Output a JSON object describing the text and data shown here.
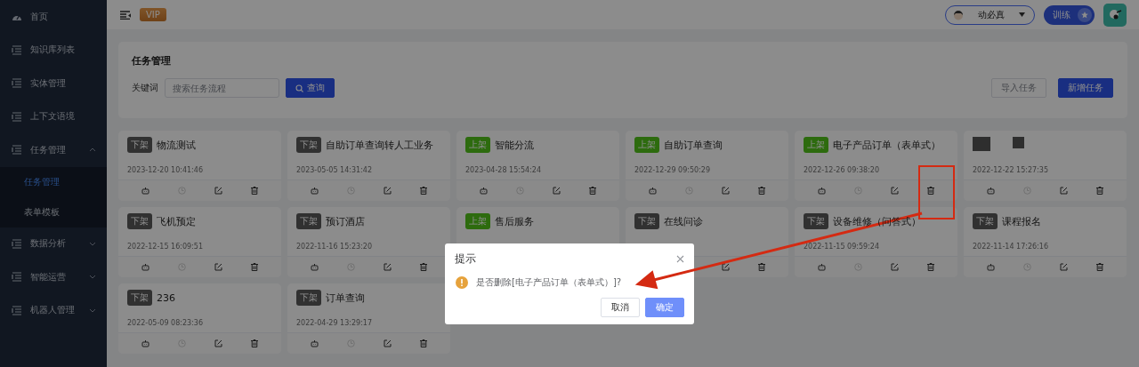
{
  "sidebar": {
    "items": [
      {
        "label": "首页",
        "kind": "dashboard"
      },
      {
        "label": "知识库列表",
        "kind": "list"
      },
      {
        "label": "实体管理",
        "kind": "list"
      },
      {
        "label": "上下文语境",
        "kind": "list"
      },
      {
        "label": "任务管理",
        "kind": "list",
        "expanded": true,
        "children": [
          {
            "label": "任务管理",
            "selected": true
          },
          {
            "label": "表单模板",
            "selected": false
          }
        ]
      },
      {
        "label": "数据分析",
        "kind": "list",
        "expanded": false
      },
      {
        "label": "智能运营",
        "kind": "list",
        "expanded": false
      },
      {
        "label": "机器人管理",
        "kind": "list",
        "expanded": false
      }
    ]
  },
  "topbar": {
    "badge": "VIP",
    "user": {
      "name": "动必真"
    },
    "train_button": "训练"
  },
  "search_panel": {
    "title": "任务管理",
    "keyword_label": "关键词",
    "placeholder": "搜索任务流程",
    "search_button": "查询",
    "import_button": {
      "label": "导入任务",
      "disabled": true
    },
    "add_button": "新增任务"
  },
  "cards": [
    {
      "status": "下架",
      "published": false,
      "title": "物流测试",
      "date": "2023-12-20 10:41:46"
    },
    {
      "status": "下架",
      "published": false,
      "title": "自助订单查询转人工业务",
      "date": "2023-05-05 14:31:42"
    },
    {
      "status": "上架",
      "published": true,
      "title": "智能分流",
      "date": "2023-04-28 15:54:24"
    },
    {
      "status": "上架",
      "published": true,
      "title": "自助订单查询",
      "date": "2022-12-29 09:50:29"
    },
    {
      "status": "上架",
      "published": true,
      "title": "电子产品订单（表单式）",
      "date": "2022-12-26 09:38:20",
      "delete_highlighted": true
    },
    {
      "redacted": true,
      "date": "2022-12-22 15:27:35"
    },
    {
      "status": "下架",
      "published": false,
      "title": "飞机预定",
      "date": "2022-12-15 16:09:51"
    },
    {
      "status": "下架",
      "published": false,
      "title": "预订酒店",
      "date": "2022-11-16 15:23:20"
    },
    {
      "status": "上架",
      "published": true,
      "title": "售后服务"
    },
    {
      "status": "下架",
      "published": false,
      "title": "在线问诊"
    },
    {
      "status": "下架",
      "published": false,
      "title": "设备维修（问答式）",
      "date": "2022-11-15 09:59:24"
    },
    {
      "status": "下架",
      "published": false,
      "title": "课程报名",
      "date": "2022-11-14 17:26:16"
    },
    {
      "status": "下架",
      "published": false,
      "title": "236",
      "date": "2022-05-09 08:23:36"
    },
    {
      "status": "下架",
      "published": false,
      "title": "订单查询",
      "date": "2022-04-29 13:29:17"
    }
  ],
  "dialog": {
    "title": "提示",
    "message": "是否删除[电子产品订单（表单式）]?",
    "cancel": "取消",
    "confirm": "确定"
  }
}
